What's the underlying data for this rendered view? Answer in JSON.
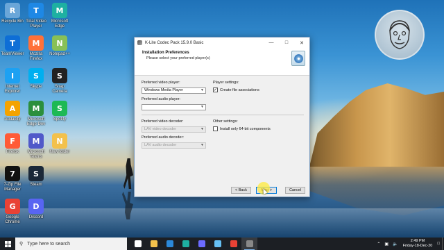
{
  "desktop": {
    "icons": [
      {
        "label": "Recycle Bin",
        "icon": "recycle-bin-icon",
        "color": "#6aa6d8"
      },
      {
        "label": "Total Video Player",
        "icon": "video-player-icon",
        "color": "#1e88e5"
      },
      {
        "label": "Microsoft Edge",
        "icon": "edge-icon",
        "color": "#1eb0a2"
      },
      {
        "label": "TeamViewer",
        "icon": "teamviewer-icon",
        "color": "#0e6ed6"
      },
      {
        "label": "Mozilla Firefox",
        "icon": "firefox-icon",
        "color": "#ff7139"
      },
      {
        "label": "Notepad++",
        "icon": "notepad-plus-icon",
        "color": "#88c057"
      },
      {
        "label": "Internet Explorer",
        "icon": "internet-explorer-icon",
        "color": "#1da1f2"
      },
      {
        "label": "Skype",
        "icon": "skype-icon",
        "color": "#00aff0"
      },
      {
        "label": "Snap Camera",
        "icon": "snap-camera-icon",
        "color": "#222222"
      },
      {
        "label": "Audacity",
        "icon": "audacity-icon",
        "color": "#f4a300"
      },
      {
        "label": "Microsoft Edge Dev",
        "icon": "edge-dev-icon",
        "color": "#2b8f3c"
      },
      {
        "label": "Spotify",
        "icon": "spotify-icon",
        "color": "#1db954"
      },
      {
        "label": "Firefox",
        "icon": "firefox-icon",
        "color": "#ff5a36"
      },
      {
        "label": "Microsoft Teams",
        "icon": "teams-icon",
        "color": "#5059c9"
      },
      {
        "label": "New folder",
        "icon": "folder-icon",
        "color": "#f3c14c"
      },
      {
        "label": "7-Zip File Manager",
        "icon": "seven-zip-icon",
        "color": "#111111"
      },
      {
        "label": "Steam",
        "icon": "steam-icon",
        "color": "#1b2838"
      },
      {
        "label": "Google Chrome",
        "icon": "chrome-icon",
        "color": "#e94235"
      },
      {
        "label": "Discord",
        "icon": "discord-icon",
        "color": "#5865f2"
      }
    ]
  },
  "dialog": {
    "title": "K-Lite Codec Pack 15.9.0 Basic",
    "header_title": "Installation Preferences",
    "header_subtitle": "Please select your preferred player(s)",
    "video_player_label": "Preferred video player:",
    "video_player_value": "Windows Media Player",
    "audio_player_label": "Preferred audio player:",
    "audio_player_value": "",
    "player_settings_label": "Player settings:",
    "file_assoc_label": "Create file associations",
    "file_assoc_checked": true,
    "video_decoder_label": "Preferred video decoder:",
    "video_decoder_value": "LAV video decoder",
    "audio_decoder_label": "Preferred audio decoder:",
    "audio_decoder_value": "LAV audio decoder",
    "other_settings_label": "Other settings:",
    "only64_label": "Install only 64-bit components",
    "only64_checked": false,
    "back_button": "< Back",
    "next_button": "Next >",
    "cancel_button": "Cancel"
  },
  "taskbar": {
    "search_placeholder": "Type here to search",
    "apps": [
      {
        "icon": "task-view-icon",
        "color": "#ffffff"
      },
      {
        "icon": "file-explorer-icon",
        "color": "#f3c14c"
      },
      {
        "icon": "store-icon",
        "color": "#2b88d8"
      },
      {
        "icon": "edge-icon",
        "color": "#1eb0a2"
      },
      {
        "icon": "media-icon",
        "color": "#6b6bff"
      },
      {
        "icon": "steam-icon",
        "color": "#66c0f4"
      },
      {
        "icon": "chrome-icon",
        "color": "#e94235"
      },
      {
        "icon": "installer-icon",
        "color": "#888888"
      }
    ],
    "time": "2:49 PM",
    "date": "Friday-18-Dec-20"
  },
  "colors": {
    "accent": "#0078d7",
    "taskbar": "#1c1f24"
  }
}
